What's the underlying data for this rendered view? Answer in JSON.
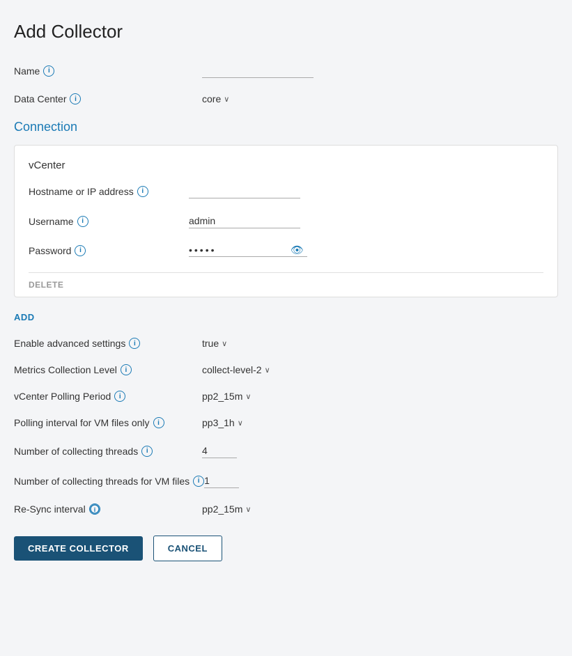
{
  "page": {
    "title": "Add Collector"
  },
  "form": {
    "name_label": "Name",
    "name_placeholder": "",
    "datacenter_label": "Data Center",
    "datacenter_value": "core",
    "connection_section": "Connection",
    "vcenter_title": "vCenter",
    "hostname_label": "Hostname or IP address",
    "hostname_value": "",
    "username_label": "Username",
    "username_value": "admin",
    "password_label": "Password",
    "password_value": "•••••",
    "delete_label": "DELETE",
    "add_label": "ADD",
    "advanced_label": "Enable advanced settings",
    "advanced_value": "true",
    "metrics_label": "Metrics Collection Level",
    "metrics_value": "collect-level-2",
    "polling_label": "vCenter Polling Period",
    "polling_value": "pp2_15m",
    "vm_polling_label": "Polling interval for VM files only",
    "vm_polling_value": "pp3_1h",
    "threads_label": "Number of collecting threads",
    "threads_value": "4",
    "vm_threads_label": "Number of collecting threads for VM files",
    "vm_threads_value": "1",
    "resync_label": "Re-Sync interval",
    "resync_value": "pp2_15m",
    "create_button": "CREATE COLLECTOR",
    "cancel_button": "CANCEL"
  },
  "icons": {
    "info": "i",
    "chevron": "∨",
    "eye": "👁"
  }
}
